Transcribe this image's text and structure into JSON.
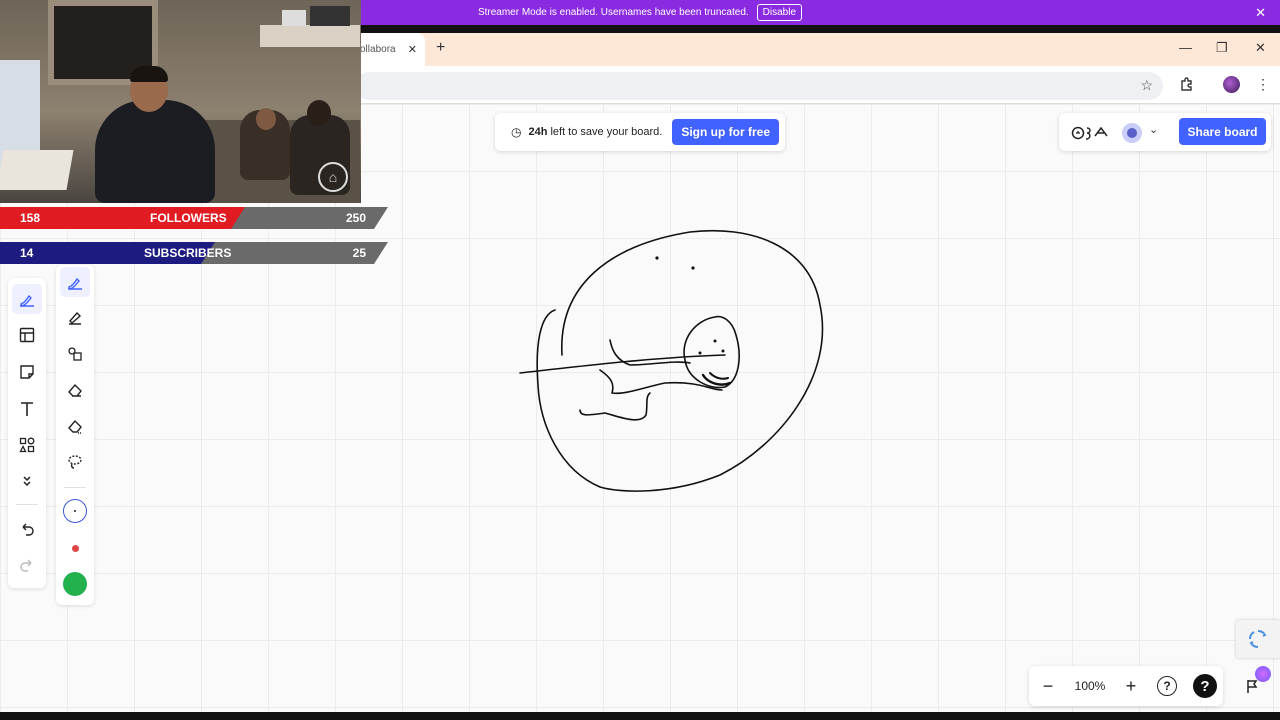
{
  "streamer_banner": {
    "message": "Streamer Mode is enabled. Usernames have been truncated.",
    "disable_label": "Disable",
    "close_glyph": "✕",
    "color": "#8a2be2"
  },
  "browser": {
    "tab_title": "ollabora",
    "tab_close_glyph": "✕",
    "new_tab_glyph": "+",
    "window_controls": [
      "—",
      "❐",
      "✕"
    ],
    "bookmark_icon": "star-icon",
    "extensions_icon": "puzzle-icon",
    "menu_icon": "kebab-icon"
  },
  "stream_overlay": {
    "followers": {
      "current": "158",
      "label": "FOLLOWERS",
      "goal": "250",
      "progress": 0.632,
      "color": "#e01b22"
    },
    "subscribers": {
      "current": "14",
      "label": "SUBSCRIBERS",
      "goal": "25",
      "progress": 0.56,
      "color": "#1d1b80"
    }
  },
  "board": {
    "save_notice": {
      "time": "24h",
      "text": "left to save your board.",
      "icon": "clock-icon"
    },
    "signup_label": "Sign up for free",
    "share_label": "Share board",
    "accent": "#4262ff"
  },
  "toolbar": {
    "main_tools": [
      "pen-icon",
      "templates-icon",
      "sticky-note-icon",
      "text-icon",
      "shapes-icon",
      "more-icon"
    ],
    "history": [
      "undo-icon",
      "redo-icon"
    ],
    "sub_tools": [
      "pen-icon",
      "highlighter-icon",
      "smart-shape-icon",
      "eraser-icon",
      "object-eraser-icon",
      "lasso-icon"
    ],
    "colors": [
      "#ffffff",
      "#e04545",
      "#22b14c"
    ]
  },
  "zoom": {
    "level": "100%",
    "minus_glyph": "−",
    "plus_glyph": "+",
    "help_glyph": "?",
    "dark_help_glyph": "?"
  }
}
